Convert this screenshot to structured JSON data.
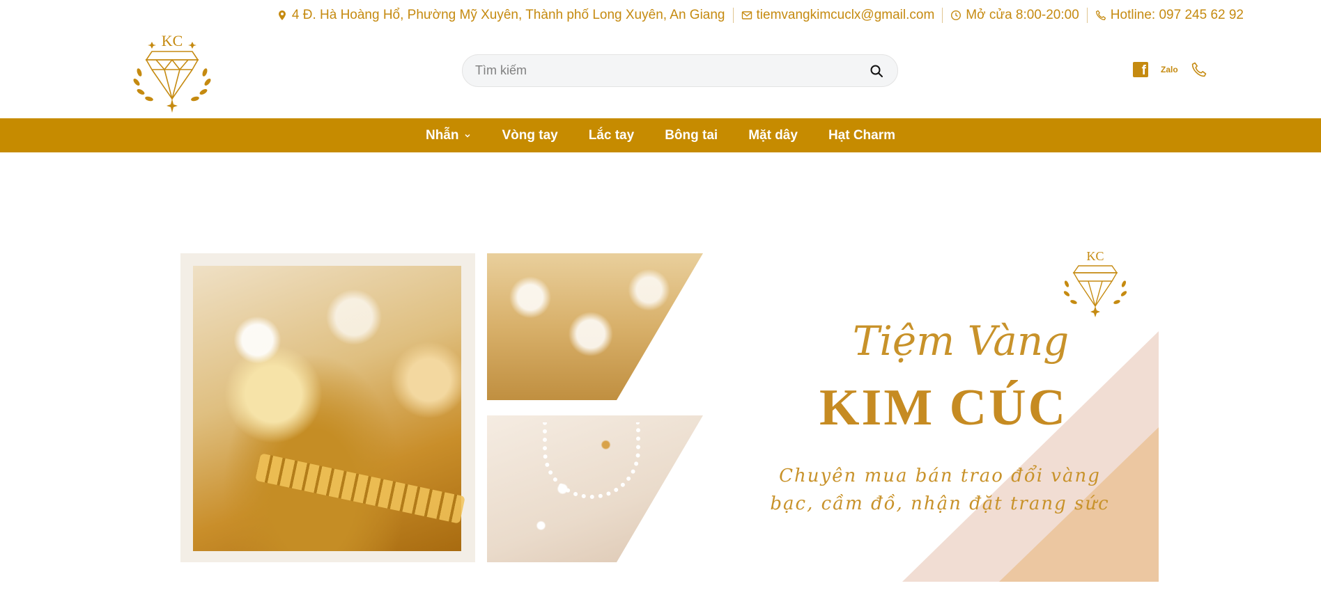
{
  "topbar": {
    "address": "4 Đ. Hà Hoàng Hổ, Phường Mỹ Xuyên, Thành phố Long Xuyên, An Giang",
    "email": "tiemvangkimcuclx@gmail.com",
    "hours": "Mở cửa 8:00-20:00",
    "hotline": "Hotline: 097 245 62 92"
  },
  "logo": {
    "monogram": "KC"
  },
  "search": {
    "placeholder": "Tìm kiếm",
    "value": ""
  },
  "social": {
    "facebook": "f",
    "zalo": "Zalo"
  },
  "nav": {
    "items": [
      {
        "label": "Nhẫn",
        "has_dropdown": true
      },
      {
        "label": "Vòng tay"
      },
      {
        "label": "Lắc tay"
      },
      {
        "label": "Bông tai"
      },
      {
        "label": "Mặt dây"
      },
      {
        "label": "Hạt Charm"
      }
    ]
  },
  "banner": {
    "logo_monogram": "KC",
    "script_title": "Tiệm Vàng",
    "main_title": "KIM CÚC",
    "tagline_line1": "Chuyên mua bán trao đổi vàng",
    "tagline_line2": "bạc, cầm đồ, nhận đặt trang sức"
  },
  "colors": {
    "gold": "#c58a10",
    "nav_bg": "#c68b00",
    "triangle_light": "#f1ddd3",
    "triangle_dark": "#ecc7a1"
  }
}
